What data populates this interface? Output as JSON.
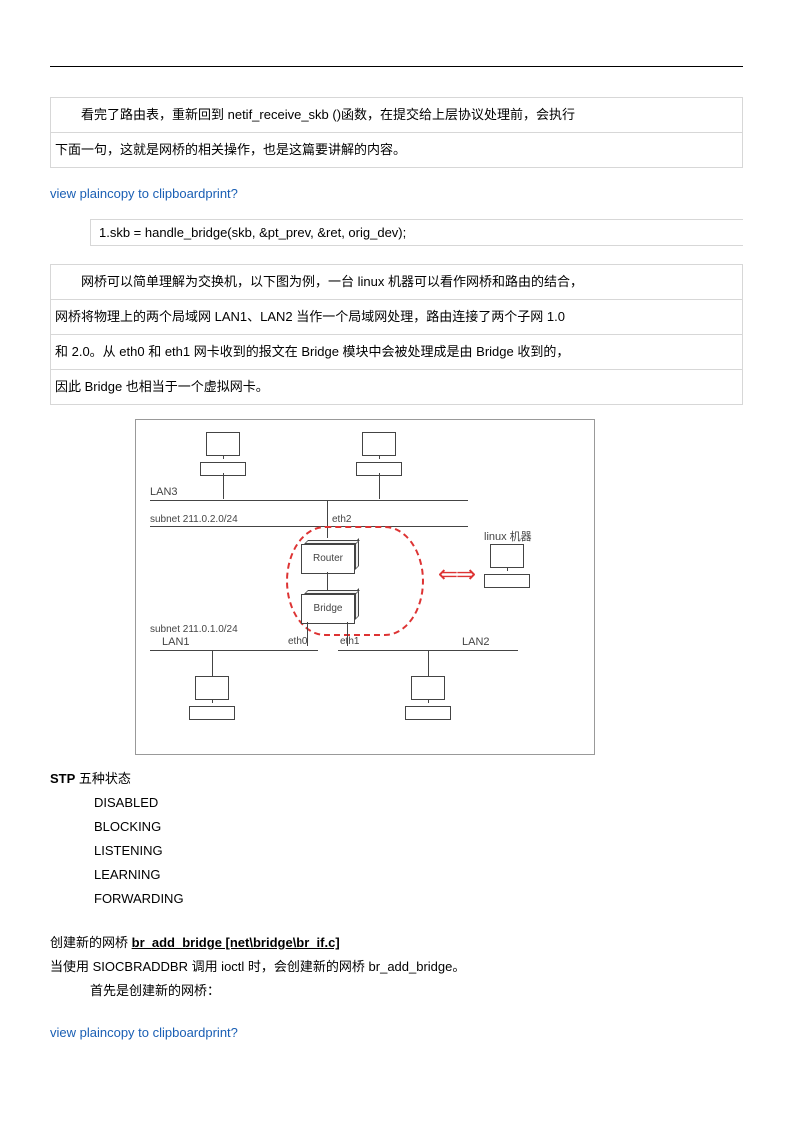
{
  "para1": {
    "line1": "看完了路由表，重新回到 netif_receive_skb ()函数，在提交给上层协议处理前，会执行",
    "line2": "下面一句，这就是网桥的相关操作，也是这篇要讲解的内容。"
  },
  "link1": "view plaincopy to clipboardprint?",
  "code1": "1.skb = handle_bridge(skb, &pt_prev, &ret, orig_dev);",
  "para2": {
    "line1": "网桥可以简单理解为交换机，以下图为例，一台 linux 机器可以看作网桥和路由的结合，",
    "line2": "网桥将物理上的两个局域网 LAN1、LAN2 当作一个局域网处理，路由连接了两个子网 1.0",
    "line3": "和 2.0。从 eth0 和 eth1 网卡收到的报文在 Bridge 模块中会被处理成是由 Bridge 收到的，",
    "line4": "因此 Bridge 也相当于一个虚拟网卡。"
  },
  "diagram": {
    "lan3": "LAN3",
    "subnet2": "subnet 211.0.2.0/24",
    "router": "Router",
    "bridge": "Bridge",
    "subnet1": "subnet 211.0.1.0/24",
    "lan1": "LAN1",
    "lan2": "LAN2",
    "eth0": "eth0",
    "eth1": "eth1",
    "eth2": "eth2",
    "linux_label": "linux 机器"
  },
  "stp": {
    "title": "STP",
    "subtitle": " 五种状态",
    "items": [
      "DISABLED",
      "BLOCKING",
      "LISTENING",
      "LEARNING",
      "FORWARDING"
    ]
  },
  "create": {
    "line1_pre": "创建新的网桥 ",
    "line1_bold": "br_add_bridge [net\\bridge\\br_if.c]",
    "line2": "当使用 SIOCBRADDBR 调用 ioctl 时，会创建新的网桥 br_add_bridge。",
    "line3": "首先是创建新的网桥："
  },
  "link2": "view plaincopy to clipboardprint?"
}
